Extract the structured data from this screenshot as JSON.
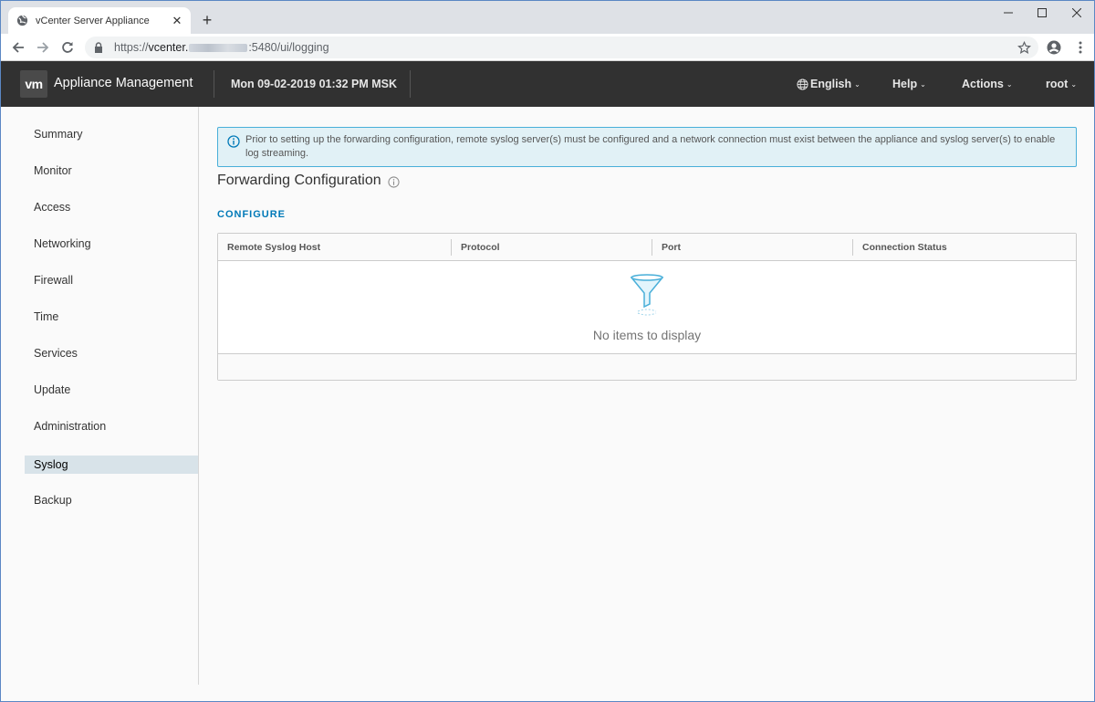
{
  "browser": {
    "tab_title": "vCenter Server Appliance",
    "url_prefix": "https://",
    "url_host": "vcenter.",
    "url_suffix": ":5480/ui/logging",
    "new_tab_label": "+",
    "close_tab_label": "✕"
  },
  "header": {
    "logo_text": "vm",
    "app_title": "Appliance Management",
    "datetime": "Mon 09-02-2019 01:32 PM MSK",
    "menus": {
      "language": "English",
      "help": "Help",
      "actions": "Actions",
      "user": "root"
    }
  },
  "sidebar": {
    "items": [
      {
        "label": "Summary"
      },
      {
        "label": "Monitor"
      },
      {
        "label": "Access"
      },
      {
        "label": "Networking"
      },
      {
        "label": "Firewall"
      },
      {
        "label": "Time"
      },
      {
        "label": "Services"
      },
      {
        "label": "Update"
      },
      {
        "label": "Administration"
      },
      {
        "label": "Syslog"
      },
      {
        "label": "Backup"
      }
    ],
    "active": "Syslog"
  },
  "main": {
    "alert_text": "Prior to setting up the forwarding configuration, remote syslog server(s) must be configured and a network connection must exist between the appliance and syslog server(s) to enable log streaming.",
    "section_title": "Forwarding Configuration",
    "configure_label": "CONFIGURE",
    "table": {
      "columns": [
        "Remote Syslog Host",
        "Protocol",
        "Port",
        "Connection Status"
      ],
      "rows": [],
      "empty_text": "No items to display"
    }
  },
  "colors": {
    "header_bg": "#313131",
    "accent_link": "#0079b8",
    "alert_bg": "#e1f1f6",
    "alert_border": "#49afd9",
    "active_nav_bg": "#d8e3e9"
  }
}
